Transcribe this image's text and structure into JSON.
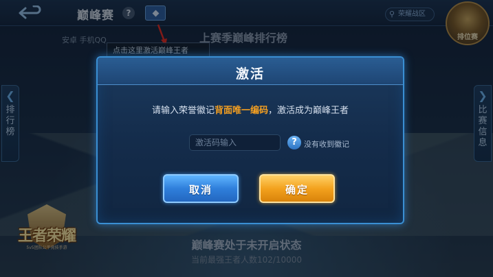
{
  "topbar": {
    "back_glyph": "⮌",
    "mode_title": "巅峰赛",
    "help_glyph": "?",
    "region_label": "荣耀战区",
    "rank_label": "排位赛"
  },
  "platform_label": "安卓 手机QQ",
  "tooltip_text": "点击这里激活巅峰王者",
  "leaderboard_title": "上赛季巅峰排行榜",
  "side_tabs": {
    "left": {
      "chevron": "❮",
      "label": "排行榜"
    },
    "right": {
      "chevron": "❯",
      "label": "比赛信息"
    }
  },
  "game_logo": {
    "name": "王者荣耀",
    "subtitle": "5v5团队公平竞技手游"
  },
  "status_line": "巅峰赛处于未开启状态",
  "count_line": "当前最强王者人数102/10000",
  "modal": {
    "title": "激活",
    "instruction_prefix": "请输入荣誉徽记",
    "instruction_highlight": "背面唯一编码",
    "instruction_suffix": "，激活成为巅峰王者",
    "input_placeholder": "激活码输入",
    "input_value": "",
    "help_glyph": "?",
    "no_badge_link": "没有收到徽记",
    "cancel_label": "取消",
    "confirm_label": "确定"
  },
  "colors": {
    "highlight": "#f6a020",
    "cancel_button": "#2f7fdb",
    "confirm_button": "#f3a21e",
    "modal_border": "#3a8fd3"
  }
}
